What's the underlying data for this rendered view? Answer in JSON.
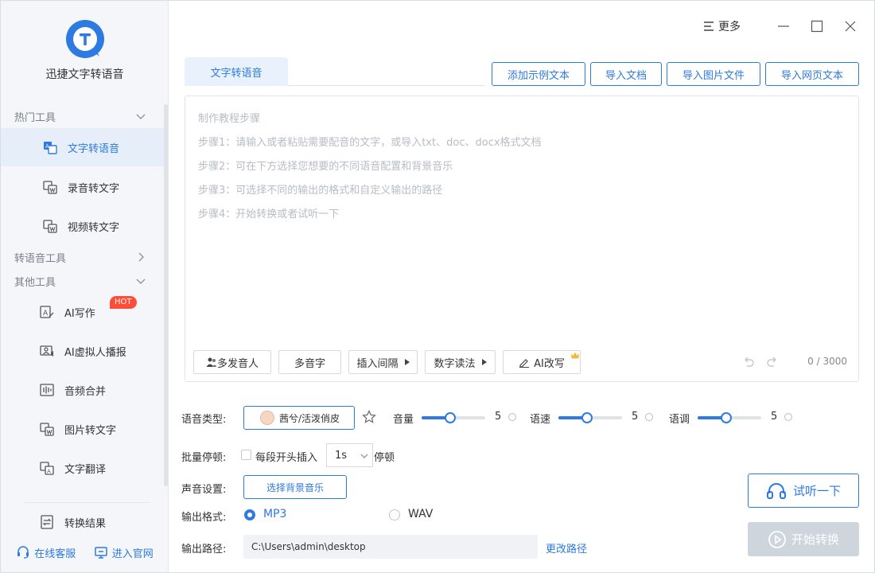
{
  "app": {
    "name": "迅捷文字转语音"
  },
  "sidebar": {
    "sections": [
      {
        "label": "热门工具",
        "chevron": "chevron-down-icon"
      },
      {
        "label": "转语音工具",
        "chevron": "chevron-right-icon"
      },
      {
        "label": "其他工具",
        "chevron": "chevron-down-icon"
      }
    ],
    "hot_items": [
      {
        "label": "文字转语音",
        "icon": "text-to-speech-icon",
        "active": true
      },
      {
        "label": "录音转文字",
        "icon": "audio-to-text-icon"
      },
      {
        "label": "视频转文字",
        "icon": "video-to-text-icon"
      }
    ],
    "other_items": [
      {
        "label": "AI写作",
        "icon": "ai-writing-icon",
        "badge": "HOT"
      },
      {
        "label": "AI虚拟人播报",
        "icon": "virtual-anchor-icon"
      },
      {
        "label": "音频合并",
        "icon": "audio-merge-icon"
      },
      {
        "label": "图片转文字",
        "icon": "image-to-text-icon"
      },
      {
        "label": "文字翻译",
        "icon": "translate-icon"
      }
    ],
    "result_item": {
      "label": "转换结果",
      "icon": "result-icon"
    },
    "footer": {
      "service": "在线客服",
      "website": "进入官网"
    }
  },
  "titlebar": {
    "more": "更多"
  },
  "tabs": [
    {
      "label": "文字转语音",
      "active": true
    }
  ],
  "top_buttons": [
    "添加示例文本",
    "导入文档",
    "导入图片文件",
    "导入网页文本"
  ],
  "editor": {
    "lines": [
      "制作教程步骤",
      "步骤1：请输入或者粘贴需要配音的文字，或导入txt、doc、docx格式文档",
      "步骤2：可在下方选择您想要的不同语音配置和背景音乐",
      "步骤3：可选择不同的输出的格式和自定义输出的路径",
      "步骤4：开始转换或者试听一下"
    ],
    "tools": {
      "multi_speaker": "多发音人",
      "polyphone": "多音字",
      "insert_pause": "插入间隔",
      "number_reading": "数字读法",
      "ai_rewrite": "AI改写"
    },
    "counter": "0 / 3000"
  },
  "settings": {
    "voice_type_label": "语音类型:",
    "voice_name": "茜兮/活泼俏皮",
    "volume": {
      "label": "音量",
      "value": "5",
      "level": 0.45
    },
    "speed": {
      "label": "语速",
      "value": "5",
      "level": 0.45
    },
    "pitch": {
      "label": "语调",
      "value": "5",
      "level": 0.45
    },
    "batch_pause_label": "批量停顿:",
    "batch_pause_check": "每段开头插入",
    "batch_pause_value": "1s",
    "batch_pause_suffix": "停顿",
    "sound_label": "声音设置:",
    "bgm_button": "选择背景音乐",
    "format_label": "输出格式:",
    "format_mp3": "MP3",
    "format_wav": "WAV",
    "path_label": "输出路径:",
    "path_value": "C:\\Users\\admin\\desktop",
    "change_path": "更改路径"
  },
  "actions": {
    "preview": "试听一下",
    "start": "开始转换"
  },
  "colors": {
    "accent": "#2d7ae0",
    "hot_badge": "#ff4d3a",
    "disabled": "#cfd5dc"
  }
}
